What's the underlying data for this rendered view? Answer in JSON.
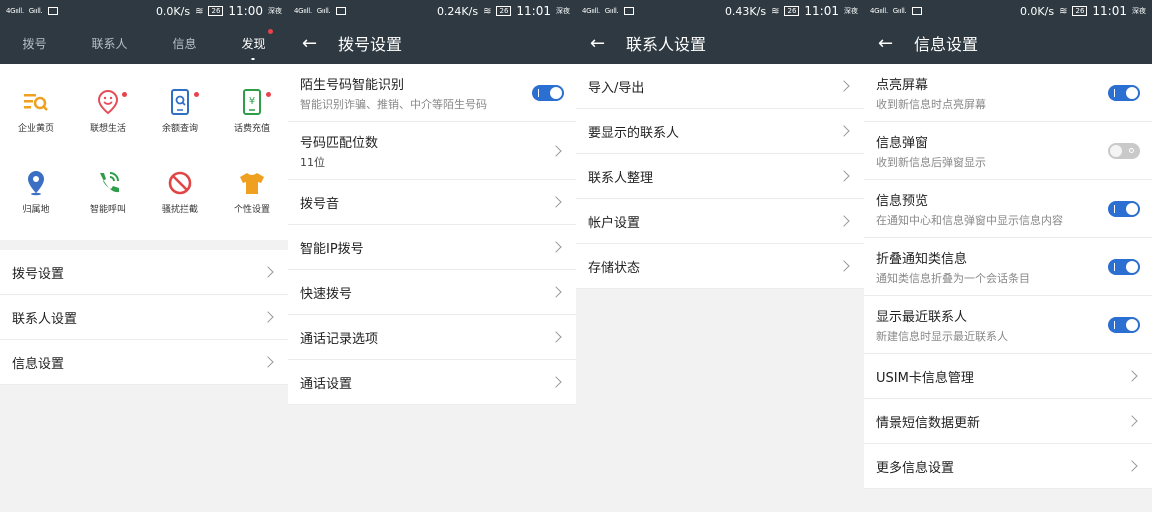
{
  "status_bars": [
    {
      "sig1": "4Gııll.",
      "sig2": "Gııll.",
      "speed": "0.0K/s",
      "battery": "26",
      "time": "11:00",
      "carrier": "深夜"
    },
    {
      "sig1": "4Gııll.",
      "sig2": "Gııll.",
      "speed": "0.24K/s",
      "battery": "26",
      "time": "11:01",
      "carrier": "深夜"
    },
    {
      "sig1": "4Gııll.",
      "sig2": "Gııll.",
      "speed": "0.43K/s",
      "battery": "26",
      "time": "11:01",
      "carrier": "深夜"
    },
    {
      "sig1": "4Gııll.",
      "sig2": "Gııll.",
      "speed": "0.0K/s",
      "battery": "26",
      "time": "11:01",
      "carrier": "深夜"
    }
  ],
  "panel1": {
    "tabs": [
      {
        "label": "拨号"
      },
      {
        "label": "联系人"
      },
      {
        "label": "信息"
      },
      {
        "label": "发现"
      }
    ],
    "grid": [
      {
        "label": "企业黄页",
        "icon": "yellowpage-icon",
        "color": "#f0a020"
      },
      {
        "label": "联想生活",
        "icon": "smile-pin-icon",
        "color": "#e54d5a"
      },
      {
        "label": "余额查询",
        "icon": "balance-phone-icon",
        "color": "#2f6fc4"
      },
      {
        "label": "话费充值",
        "icon": "recharge-phone-icon",
        "color": "#2e9e4a"
      },
      {
        "label": "归属地",
        "icon": "location-icon",
        "color": "#3a6fc4"
      },
      {
        "label": "智能呼叫",
        "icon": "smart-call-icon",
        "color": "#2e9e4a"
      },
      {
        "label": "骚扰拦截",
        "icon": "block-icon",
        "color": "#e04646"
      },
      {
        "label": "个性设置",
        "icon": "shirt-icon",
        "color": "#f0a020"
      }
    ],
    "rows": [
      {
        "label": "拨号设置"
      },
      {
        "label": "联系人设置"
      },
      {
        "label": "信息设置"
      }
    ]
  },
  "panel2": {
    "title": "拨号设置",
    "rows": [
      {
        "label": "陌生号码智能识别",
        "sub": "智能识别诈骗、推销、中介等陌生号码"
      },
      {
        "label": "号码匹配位数",
        "sub": "11位"
      },
      {
        "label": "拨号音"
      },
      {
        "label": "智能IP拨号"
      },
      {
        "label": "快速拨号"
      },
      {
        "label": "通话记录选项"
      },
      {
        "label": "通话设置"
      }
    ]
  },
  "panel3": {
    "title": "联系人设置",
    "rows": [
      {
        "label": "导入/导出"
      },
      {
        "label": "要显示的联系人"
      },
      {
        "label": "联系人整理"
      },
      {
        "label": "帐户设置"
      },
      {
        "label": "存储状态"
      }
    ]
  },
  "panel4": {
    "title": "信息设置",
    "rows": [
      {
        "label": "点亮屏幕",
        "sub": "收到新信息时点亮屏幕",
        "toggle": "on"
      },
      {
        "label": "信息弹窗",
        "sub": "收到新信息后弹窗显示",
        "toggle": "off"
      },
      {
        "label": "信息预览",
        "sub": "在通知中心和信息弹窗中显示信息内容",
        "toggle": "on"
      },
      {
        "label": "折叠通知类信息",
        "sub": "通知类信息折叠为一个会话条目",
        "toggle": "on"
      },
      {
        "label": "显示最近联系人",
        "sub": "新建信息时显示最近联系人",
        "toggle": "on"
      },
      {
        "label": "USIM卡信息管理"
      },
      {
        "label": "情景短信数据更新"
      },
      {
        "label": "更多信息设置"
      }
    ]
  },
  "colors": {
    "header": "#2e3941",
    "switch_on": "#2a6fd1",
    "switch_off": "#c9c9c9",
    "badge": "#e9424c"
  }
}
